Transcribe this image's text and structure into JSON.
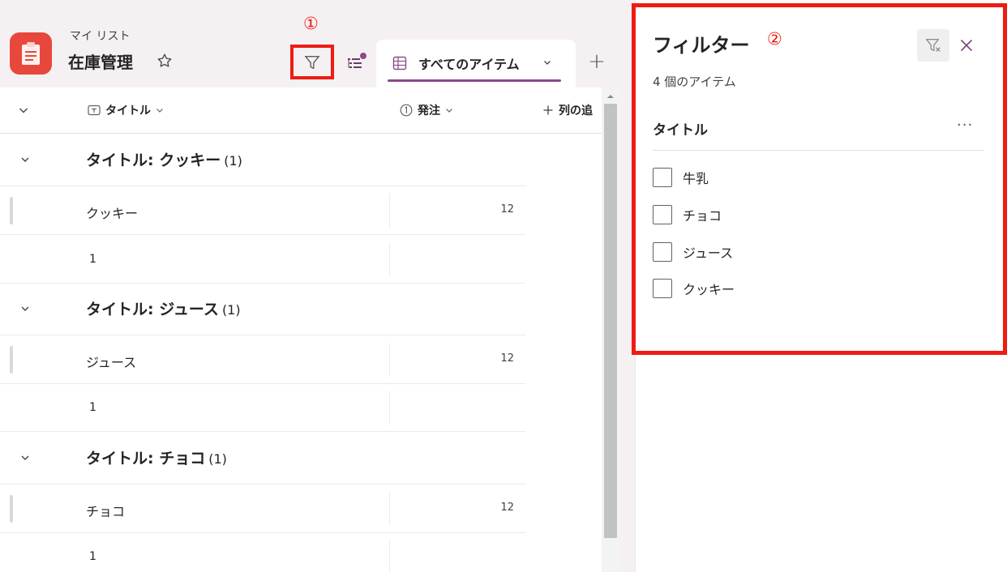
{
  "header": {
    "supertitle": "マイ リスト",
    "list_title": "在庫管理",
    "filter_marker": "①",
    "view_tab_label": "すべてのアイテム",
    "add_view_label": "+",
    "app_icon": "clipboard-icon"
  },
  "columns": [
    {
      "label": "タイトル",
      "icon": "title-column-icon"
    },
    {
      "label": "発注",
      "icon": "number-column-icon"
    },
    {
      "label": "列の追",
      "icon": "plus-icon"
    }
  ],
  "groups": [
    {
      "label": "タイトル: クッキー",
      "count": "(1)",
      "title": "クッキー",
      "value": "12",
      "sub": "1"
    },
    {
      "label": "タイトル: ジュース",
      "count": "(1)",
      "title": "ジュース",
      "value": "12",
      "sub": "1"
    },
    {
      "label": "タイトル: チョコ",
      "count": "(1)",
      "title": "チョコ",
      "value": "12",
      "sub": "1"
    }
  ],
  "filter_pane": {
    "title": "フィルター",
    "marker": "②",
    "item_count": "4 個のアイテム",
    "section_title": "タイトル",
    "section_more": "···",
    "options": [
      "牛乳",
      "チョコ",
      "ジュース",
      "クッキー"
    ]
  },
  "colors": {
    "annotation_red": "#ee1c12",
    "app_icon_red": "#e8473c",
    "accent_purple": "#8d4a87",
    "header_background": "#f5f1f3"
  }
}
